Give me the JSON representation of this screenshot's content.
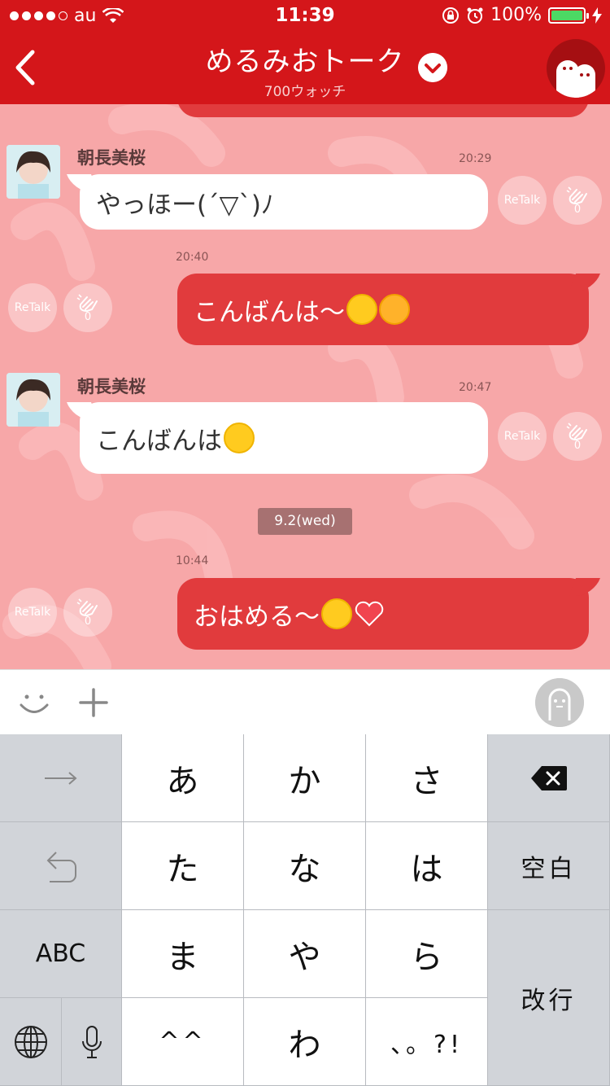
{
  "status_bar": {
    "carrier": "au",
    "time": "11:39",
    "battery": "100%",
    "battery_level": 1.0
  },
  "header": {
    "title": "めるみおトーク",
    "subtitle": "700ウォッチ"
  },
  "messages": [
    {
      "direction": "incoming",
      "sender": "朝長美桜",
      "time": "20:29",
      "text": "やっほー(´▽`)ﾉ",
      "emoji": [],
      "retalk_label": "ReTalk",
      "clap_count": "0"
    },
    {
      "direction": "outgoing",
      "time": "20:40",
      "text": "こんばんは〜",
      "emoji": [
        "smile-emoji",
        "moon-emoji"
      ],
      "retalk_label": "ReTalk",
      "clap_count": "0"
    },
    {
      "direction": "incoming",
      "sender": "朝長美桜",
      "time": "20:47",
      "text": "こんばんは",
      "emoji": [
        "smile-emoji"
      ],
      "retalk_label": "ReTalk",
      "clap_count": "0"
    },
    {
      "direction": "outgoing",
      "time": "10:44",
      "text": "おはめる〜",
      "emoji": [
        "smile-emoji",
        "heart-emoji"
      ],
      "retalk_label": "ReTalk",
      "clap_count": "0"
    }
  ],
  "date_separator": "9.2(wed)",
  "keyboard": {
    "row1": [
      "→",
      "あ",
      "か",
      "さ",
      "⌫"
    ],
    "row2": [
      "↺",
      "た",
      "な",
      "は",
      "空白"
    ],
    "row3": [
      "ABC",
      "ま",
      "や",
      "ら",
      "改行"
    ],
    "row4": [
      "globe",
      "mic",
      "^^",
      "わ",
      "、。?!"
    ]
  },
  "colors": {
    "header_red": "#d4161a",
    "chat_bg": "#f7a7a8",
    "outgoing_bubble": "#e13b3d",
    "incoming_bubble": "#ffffff"
  }
}
